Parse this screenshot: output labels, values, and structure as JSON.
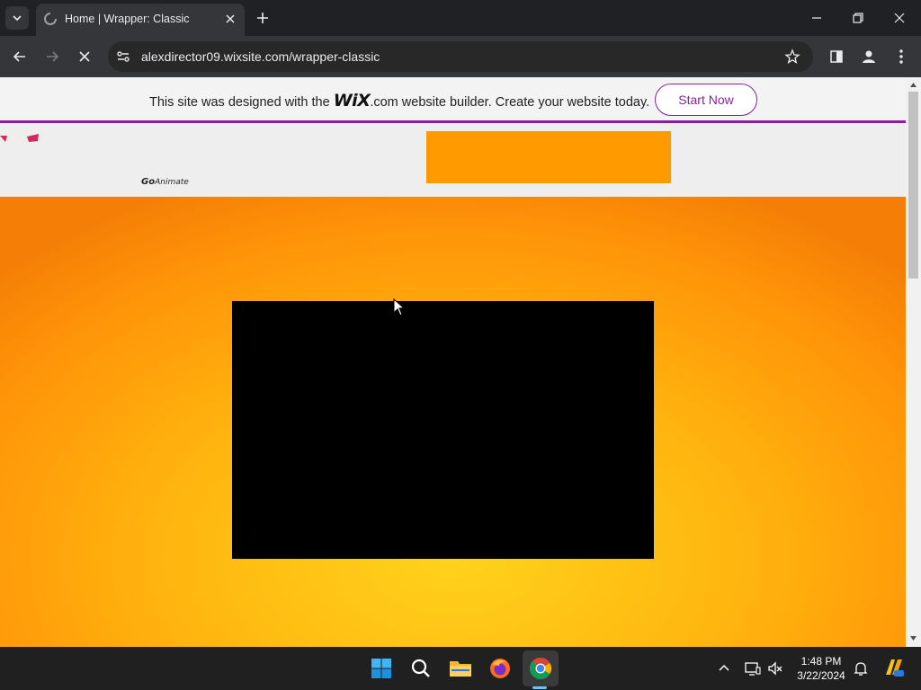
{
  "browser": {
    "tab_title": "Home | Wrapper: Classic",
    "url": "alexdirector09.wixsite.com/wrapper-classic"
  },
  "wix_banner": {
    "text_before": "This site was designed with the ",
    "logo": "WiX",
    "text_after": ".com website builder. Create your website today.",
    "button": "Start Now",
    "accent": "#8a1ea0"
  },
  "site": {
    "logo_text_bold": "Go",
    "logo_text_rest": "Animate",
    "header_box_color": "#ff9a00",
    "hero_colors": [
      "#ffd21c",
      "#ff9508"
    ],
    "video_bg": "#000000"
  },
  "taskbar": {
    "time": "1:48 PM",
    "date": "3/22/2024",
    "apps": [
      "windows-start-icon",
      "search-icon",
      "file-explorer-icon",
      "firefox-icon",
      "chrome-icon"
    ]
  }
}
